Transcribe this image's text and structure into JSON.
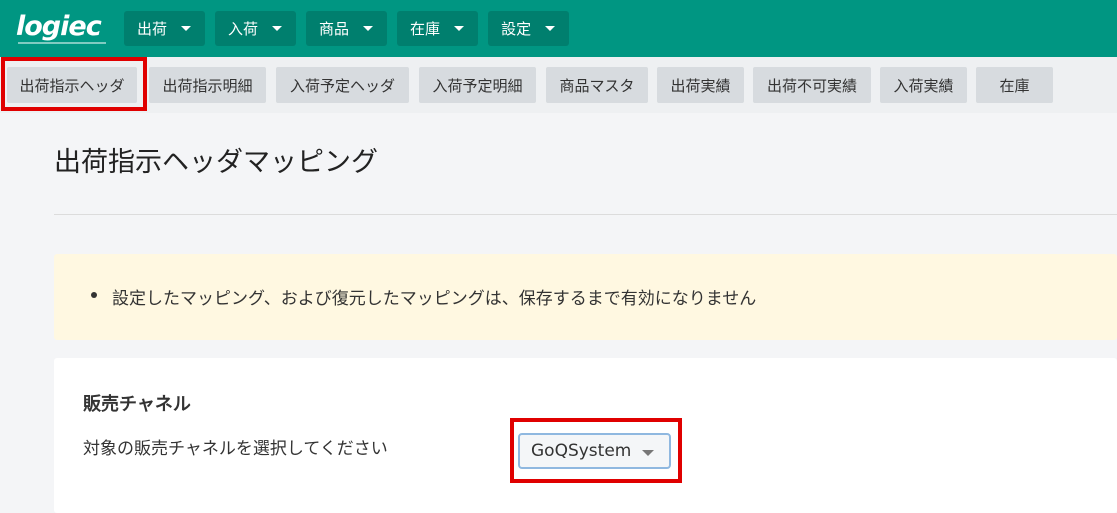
{
  "brand": {
    "logo_text": "logiec",
    "accent_color": "#009682"
  },
  "menu": [
    {
      "label": "出荷"
    },
    {
      "label": "入荷"
    },
    {
      "label": "商品"
    },
    {
      "label": "在庫"
    },
    {
      "label": "設定"
    }
  ],
  "subtabs": [
    {
      "label": "出荷指示ヘッダ",
      "selected": true
    },
    {
      "label": "出荷指示明細"
    },
    {
      "label": "入荷予定ヘッダ"
    },
    {
      "label": "入荷予定明細"
    },
    {
      "label": "商品マスタ"
    },
    {
      "label": "出荷実績"
    },
    {
      "label": "出荷不可実績"
    },
    {
      "label": "入荷実績"
    },
    {
      "label": "在庫"
    }
  ],
  "page": {
    "title": "出荷指示ヘッダマッピング"
  },
  "notice": {
    "items": [
      "設定したマッピング、および復元したマッピングは、保存するまで有効になりません"
    ]
  },
  "channel": {
    "title": "販売チャネル",
    "description": "対象の販売チャネルを選択してください",
    "selected": "GoQSystem"
  }
}
